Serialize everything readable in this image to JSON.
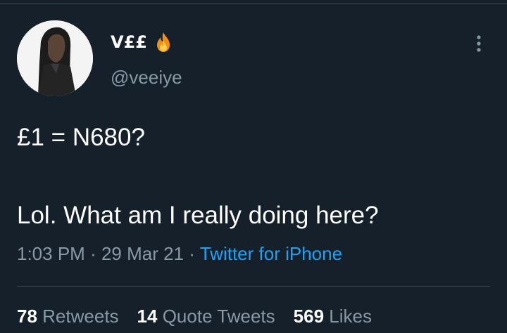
{
  "tweet": {
    "display_name": "V££",
    "name_emoji": "fire-icon",
    "handle": "@veeiye",
    "line1": "£1 = N680?",
    "line2": "Lol. What am I really doing here?",
    "time": "1:03 PM",
    "date": "29 Mar 21",
    "separator": "·",
    "source": "Twitter for iPhone"
  },
  "stats": [
    {
      "count": "78",
      "label": "Retweets"
    },
    {
      "count": "14",
      "label": "Quote Tweets"
    },
    {
      "count": "569",
      "label": "Likes"
    }
  ],
  "colors": {
    "background": "#15202b",
    "text": "#ffffff",
    "secondary": "#8899a6",
    "link": "#1da1f2",
    "divider": "#38444d"
  }
}
